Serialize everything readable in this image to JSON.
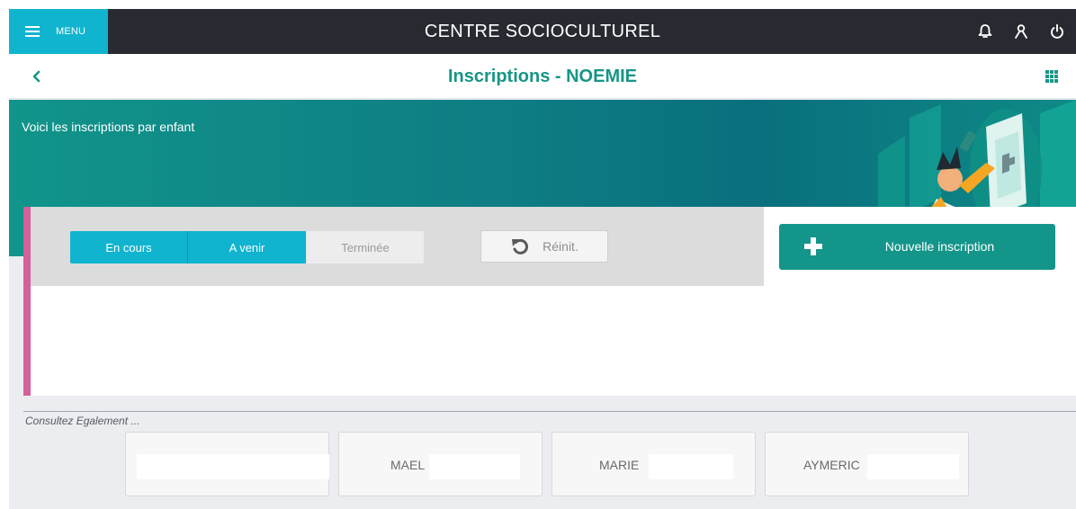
{
  "topbar": {
    "menu_label": "MENU",
    "app_title": "CENTRE SOCIOCULTUREL",
    "icons": [
      "bell-icon",
      "user-icon",
      "power-icon"
    ],
    "bg_color": "#272b31",
    "accent_color": "#10b4cf"
  },
  "subheader": {
    "title": "Inscriptions  -  NOEMIE",
    "title_color": "#179687"
  },
  "banner": {
    "text": "Voici les inscriptions par enfant"
  },
  "filters": {
    "tabs": [
      {
        "label": "En cours",
        "active": true
      },
      {
        "label": "A venir",
        "active": true
      },
      {
        "label": "Terminée",
        "active": false
      }
    ],
    "reset_label": "Réinit."
  },
  "actions": {
    "new_label": "Nouvelle inscription"
  },
  "consult": {
    "heading": "Consultez Egalement ...",
    "children": [
      "",
      "MAEL",
      "MARIE",
      "AYMERIC"
    ]
  }
}
